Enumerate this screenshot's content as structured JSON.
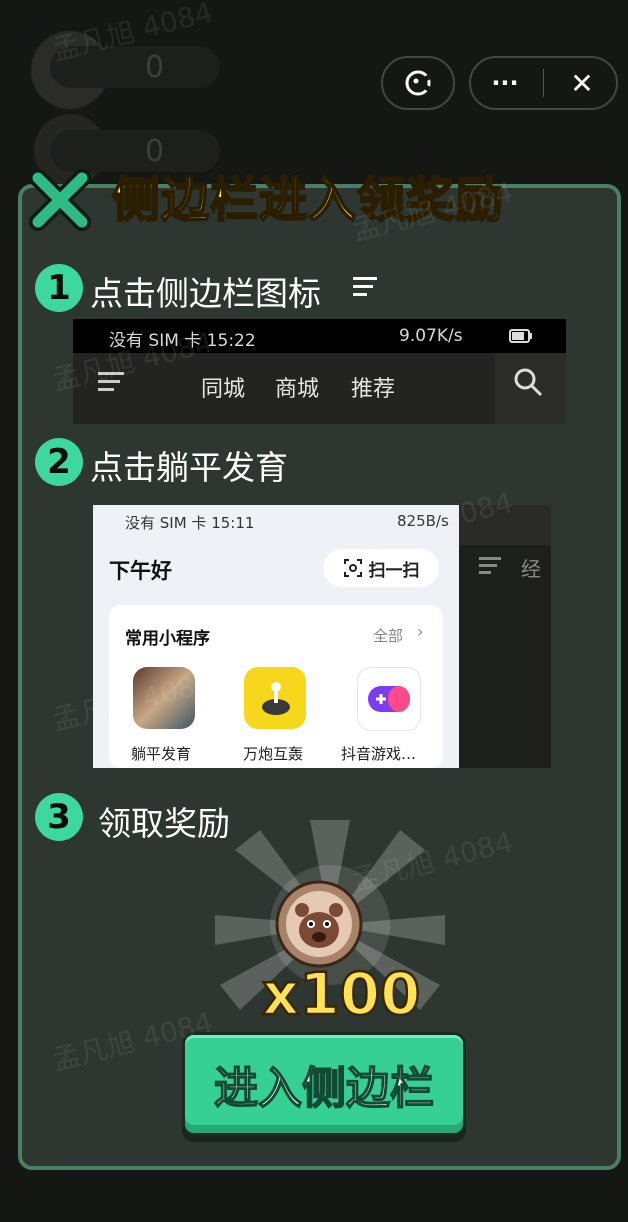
{
  "background": {
    "counters": [
      "0",
      "0"
    ],
    "watermarks": [
      "孟凡旭 4084",
      "孟凡旭 4084",
      "孟凡旭 4084",
      "孟凡旭 4084",
      "孟凡旭 4084",
      "孟凡旭 4084",
      "孟凡旭 4084"
    ]
  },
  "capsule": {
    "more_label": "···",
    "close_label": "✕"
  },
  "dialog": {
    "title": "侧边栏进入领奖励",
    "steps": [
      {
        "num": "1",
        "label": "点击侧边栏图标"
      },
      {
        "num": "2",
        "label": "点击躺平发育"
      },
      {
        "num": "3",
        "label": "领取奖励"
      }
    ],
    "screenshot1": {
      "status_left": "没有 SIM 卡 15:22",
      "status_right": "9.07K/s",
      "nav_tabs": [
        "同城",
        "商城",
        "推荐"
      ]
    },
    "screenshot2": {
      "status_left": "没有 SIM 卡 15:11",
      "status_right": "825B/s",
      "greeting": "下午好",
      "scan_label": "扫一扫",
      "section_title": "常用小程序",
      "section_all": "全部",
      "apps": [
        "躺平发育",
        "万炮互轰",
        "抖音游戏…"
      ],
      "right_glyph": "经"
    },
    "reward": {
      "amount": "x100"
    },
    "cta_label": "进入侧边栏"
  },
  "colors": {
    "accent_green": "#3dd7a1",
    "title_yellow": "#fde24a",
    "panel": "#2d3630",
    "panel_border": "#4a7f63"
  }
}
